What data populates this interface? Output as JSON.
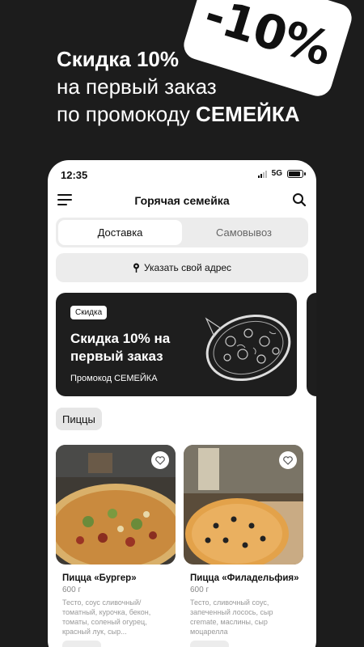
{
  "promo": {
    "badge": "-10%",
    "line1": "Скидка 10%",
    "line2": "на первый заказ",
    "line3_prefix": "по промокоду ",
    "line3_code": "СЕМЕЙКА"
  },
  "status_bar": {
    "time": "12:35",
    "network": "5G"
  },
  "header": {
    "title": "Горячая семейка"
  },
  "delivery_tabs": [
    {
      "label": "Доставка",
      "active": true
    },
    {
      "label": "Самовывоз",
      "active": false
    }
  ],
  "address": {
    "label": "Указать свой адрес"
  },
  "banner": {
    "tag": "Скидка",
    "title": "Скидка 10% на первый заказ",
    "code_text": "Промокод СЕМЕЙКА"
  },
  "category": {
    "label": "Пиццы"
  },
  "products": [
    {
      "name": "Пицца «Бургер»",
      "weight": "600 г",
      "description": "Тесто, соус сливочный/томатный, курочка, бекон, томаты, соленый огурец, красный лук, сыр..."
    },
    {
      "name": "Пицца «Филадельфия»",
      "weight": "600 г",
      "description": "Тесто, сливочный соус, запеченный лосось, сыр cremate, маслины, сыр моцарелла"
    }
  ],
  "colors": {
    "background": "#1c1c1c",
    "surface": "#ffffff",
    "chip": "#ececec",
    "banner": "#1e1e1e"
  }
}
